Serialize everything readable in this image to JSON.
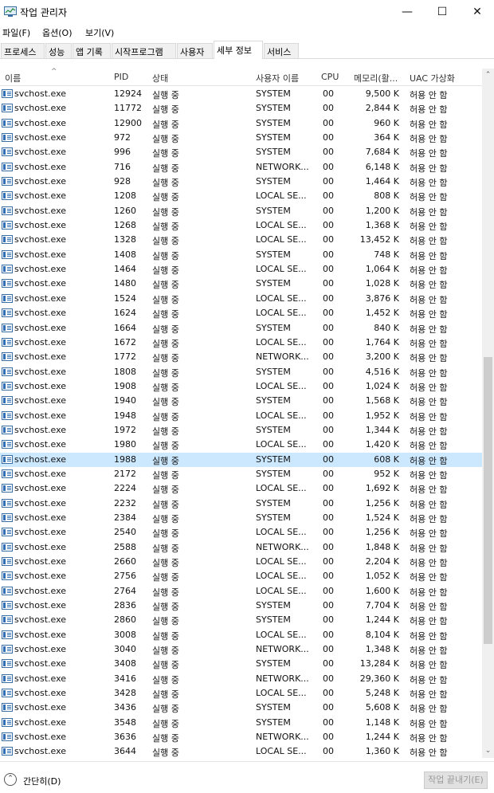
{
  "window": {
    "title": "작업 관리자",
    "icon": "task-manager-icon",
    "minimize": "—",
    "maximize": "☐",
    "close": "✕"
  },
  "menu": [
    "파일(F)",
    "옵션(O)",
    "보기(V)"
  ],
  "tabs": [
    {
      "label": "프로세스",
      "active": false
    },
    {
      "label": "성능",
      "active": false
    },
    {
      "label": "앱 기록",
      "active": false
    },
    {
      "label": "시작프로그램",
      "active": false
    },
    {
      "label": "사용자",
      "active": false
    },
    {
      "label": "세부 정보",
      "active": true
    },
    {
      "label": "서비스",
      "active": false
    }
  ],
  "columns": {
    "name": "이름",
    "pid": "PID",
    "status": "상태",
    "user": "사용자 이름",
    "cpu": "CPU",
    "memory": "메모리(활...",
    "uac": "UAC 가상화"
  },
  "sort_indicator": "^",
  "selected_pid": "1988",
  "rows": [
    {
      "name": "svchost.exe",
      "pid": "12924",
      "status": "실행 중",
      "user": "SYSTEM",
      "cpu": "00",
      "memory": "9,500 K",
      "uac": "허용 안 함"
    },
    {
      "name": "svchost.exe",
      "pid": "11772",
      "status": "실행 중",
      "user": "SYSTEM",
      "cpu": "00",
      "memory": "2,844 K",
      "uac": "허용 안 함"
    },
    {
      "name": "svchost.exe",
      "pid": "12900",
      "status": "실행 중",
      "user": "SYSTEM",
      "cpu": "00",
      "memory": "960 K",
      "uac": "허용 안 함"
    },
    {
      "name": "svchost.exe",
      "pid": "972",
      "status": "실행 중",
      "user": "SYSTEM",
      "cpu": "00",
      "memory": "364 K",
      "uac": "허용 안 함"
    },
    {
      "name": "svchost.exe",
      "pid": "996",
      "status": "실행 중",
      "user": "SYSTEM",
      "cpu": "00",
      "memory": "7,684 K",
      "uac": "허용 안 함"
    },
    {
      "name": "svchost.exe",
      "pid": "716",
      "status": "실행 중",
      "user": "NETWORK...",
      "cpu": "00",
      "memory": "6,148 K",
      "uac": "허용 안 함"
    },
    {
      "name": "svchost.exe",
      "pid": "928",
      "status": "실행 중",
      "user": "SYSTEM",
      "cpu": "00",
      "memory": "1,464 K",
      "uac": "허용 안 함"
    },
    {
      "name": "svchost.exe",
      "pid": "1208",
      "status": "실행 중",
      "user": "LOCAL SE...",
      "cpu": "00",
      "memory": "808 K",
      "uac": "허용 안 함"
    },
    {
      "name": "svchost.exe",
      "pid": "1260",
      "status": "실행 중",
      "user": "SYSTEM",
      "cpu": "00",
      "memory": "1,200 K",
      "uac": "허용 안 함"
    },
    {
      "name": "svchost.exe",
      "pid": "1268",
      "status": "실행 중",
      "user": "LOCAL SE...",
      "cpu": "00",
      "memory": "1,368 K",
      "uac": "허용 안 함"
    },
    {
      "name": "svchost.exe",
      "pid": "1328",
      "status": "실행 중",
      "user": "LOCAL SE...",
      "cpu": "00",
      "memory": "13,452 K",
      "uac": "허용 안 함"
    },
    {
      "name": "svchost.exe",
      "pid": "1408",
      "status": "실행 중",
      "user": "SYSTEM",
      "cpu": "00",
      "memory": "748 K",
      "uac": "허용 안 함"
    },
    {
      "name": "svchost.exe",
      "pid": "1464",
      "status": "실행 중",
      "user": "LOCAL SE...",
      "cpu": "00",
      "memory": "1,064 K",
      "uac": "허용 안 함"
    },
    {
      "name": "svchost.exe",
      "pid": "1480",
      "status": "실행 중",
      "user": "SYSTEM",
      "cpu": "00",
      "memory": "1,028 K",
      "uac": "허용 안 함"
    },
    {
      "name": "svchost.exe",
      "pid": "1524",
      "status": "실행 중",
      "user": "LOCAL SE...",
      "cpu": "00",
      "memory": "3,876 K",
      "uac": "허용 안 함"
    },
    {
      "name": "svchost.exe",
      "pid": "1624",
      "status": "실행 중",
      "user": "LOCAL SE...",
      "cpu": "00",
      "memory": "1,452 K",
      "uac": "허용 안 함"
    },
    {
      "name": "svchost.exe",
      "pid": "1664",
      "status": "실행 중",
      "user": "SYSTEM",
      "cpu": "00",
      "memory": "840 K",
      "uac": "허용 안 함"
    },
    {
      "name": "svchost.exe",
      "pid": "1672",
      "status": "실행 중",
      "user": "LOCAL SE...",
      "cpu": "00",
      "memory": "1,764 K",
      "uac": "허용 안 함"
    },
    {
      "name": "svchost.exe",
      "pid": "1772",
      "status": "실행 중",
      "user": "NETWORK...",
      "cpu": "00",
      "memory": "3,200 K",
      "uac": "허용 안 함"
    },
    {
      "name": "svchost.exe",
      "pid": "1808",
      "status": "실행 중",
      "user": "SYSTEM",
      "cpu": "00",
      "memory": "4,516 K",
      "uac": "허용 안 함"
    },
    {
      "name": "svchost.exe",
      "pid": "1908",
      "status": "실행 중",
      "user": "LOCAL SE...",
      "cpu": "00",
      "memory": "1,024 K",
      "uac": "허용 안 함"
    },
    {
      "name": "svchost.exe",
      "pid": "1940",
      "status": "실행 중",
      "user": "SYSTEM",
      "cpu": "00",
      "memory": "1,568 K",
      "uac": "허용 안 함"
    },
    {
      "name": "svchost.exe",
      "pid": "1948",
      "status": "실행 중",
      "user": "LOCAL SE...",
      "cpu": "00",
      "memory": "1,952 K",
      "uac": "허용 안 함"
    },
    {
      "name": "svchost.exe",
      "pid": "1972",
      "status": "실행 중",
      "user": "SYSTEM",
      "cpu": "00",
      "memory": "1,344 K",
      "uac": "허용 안 함"
    },
    {
      "name": "svchost.exe",
      "pid": "1980",
      "status": "실행 중",
      "user": "LOCAL SE...",
      "cpu": "00",
      "memory": "1,420 K",
      "uac": "허용 안 함"
    },
    {
      "name": "svchost.exe",
      "pid": "1988",
      "status": "실행 중",
      "user": "SYSTEM",
      "cpu": "00",
      "memory": "608 K",
      "uac": "허용 안 함"
    },
    {
      "name": "svchost.exe",
      "pid": "2172",
      "status": "실행 중",
      "user": "SYSTEM",
      "cpu": "00",
      "memory": "952 K",
      "uac": "허용 안 함"
    },
    {
      "name": "svchost.exe",
      "pid": "2224",
      "status": "실행 중",
      "user": "LOCAL SE...",
      "cpu": "00",
      "memory": "1,692 K",
      "uac": "허용 안 함"
    },
    {
      "name": "svchost.exe",
      "pid": "2232",
      "status": "실행 중",
      "user": "SYSTEM",
      "cpu": "00",
      "memory": "1,256 K",
      "uac": "허용 안 함"
    },
    {
      "name": "svchost.exe",
      "pid": "2384",
      "status": "실행 중",
      "user": "SYSTEM",
      "cpu": "00",
      "memory": "1,524 K",
      "uac": "허용 안 함"
    },
    {
      "name": "svchost.exe",
      "pid": "2540",
      "status": "실행 중",
      "user": "LOCAL SE...",
      "cpu": "00",
      "memory": "1,256 K",
      "uac": "허용 안 함"
    },
    {
      "name": "svchost.exe",
      "pid": "2588",
      "status": "실행 중",
      "user": "NETWORK...",
      "cpu": "00",
      "memory": "1,848 K",
      "uac": "허용 안 함"
    },
    {
      "name": "svchost.exe",
      "pid": "2660",
      "status": "실행 중",
      "user": "LOCAL SE...",
      "cpu": "00",
      "memory": "2,204 K",
      "uac": "허용 안 함"
    },
    {
      "name": "svchost.exe",
      "pid": "2756",
      "status": "실행 중",
      "user": "LOCAL SE...",
      "cpu": "00",
      "memory": "1,052 K",
      "uac": "허용 안 함"
    },
    {
      "name": "svchost.exe",
      "pid": "2764",
      "status": "실행 중",
      "user": "LOCAL SE...",
      "cpu": "00",
      "memory": "1,600 K",
      "uac": "허용 안 함"
    },
    {
      "name": "svchost.exe",
      "pid": "2836",
      "status": "실행 중",
      "user": "SYSTEM",
      "cpu": "00",
      "memory": "7,704 K",
      "uac": "허용 안 함"
    },
    {
      "name": "svchost.exe",
      "pid": "2860",
      "status": "실행 중",
      "user": "SYSTEM",
      "cpu": "00",
      "memory": "1,244 K",
      "uac": "허용 안 함"
    },
    {
      "name": "svchost.exe",
      "pid": "3008",
      "status": "실행 중",
      "user": "LOCAL SE...",
      "cpu": "00",
      "memory": "8,104 K",
      "uac": "허용 안 함"
    },
    {
      "name": "svchost.exe",
      "pid": "3040",
      "status": "실행 중",
      "user": "NETWORK...",
      "cpu": "00",
      "memory": "1,348 K",
      "uac": "허용 안 함"
    },
    {
      "name": "svchost.exe",
      "pid": "3408",
      "status": "실행 중",
      "user": "SYSTEM",
      "cpu": "00",
      "memory": "13,284 K",
      "uac": "허용 안 함"
    },
    {
      "name": "svchost.exe",
      "pid": "3416",
      "status": "실행 중",
      "user": "NETWORK...",
      "cpu": "00",
      "memory": "29,360 K",
      "uac": "허용 안 함"
    },
    {
      "name": "svchost.exe",
      "pid": "3428",
      "status": "실행 중",
      "user": "LOCAL SE...",
      "cpu": "00",
      "memory": "5,248 K",
      "uac": "허용 안 함"
    },
    {
      "name": "svchost.exe",
      "pid": "3436",
      "status": "실행 중",
      "user": "SYSTEM",
      "cpu": "00",
      "memory": "5,608 K",
      "uac": "허용 안 함"
    },
    {
      "name": "svchost.exe",
      "pid": "3548",
      "status": "실행 중",
      "user": "SYSTEM",
      "cpu": "00",
      "memory": "1,148 K",
      "uac": "허용 안 함"
    },
    {
      "name": "svchost.exe",
      "pid": "3636",
      "status": "실행 중",
      "user": "NETWORK...",
      "cpu": "00",
      "memory": "1,244 K",
      "uac": "허용 안 함"
    },
    {
      "name": "svchost.exe",
      "pid": "3644",
      "status": "실행 중",
      "user": "LOCAL SE...",
      "cpu": "00",
      "memory": "1,360 K",
      "uac": "허용 안 함"
    }
  ],
  "scrollbar": {
    "up": "⌃",
    "down": "⌄",
    "thumb_position": 0.42
  },
  "footer": {
    "collapse_icon": "⌃",
    "collapse_label": "간단히(D)",
    "end_task_label": "작업 끝내기(E)"
  },
  "colors": {
    "selected_row": "#cce8ff",
    "window_bg": "#ffffff"
  }
}
